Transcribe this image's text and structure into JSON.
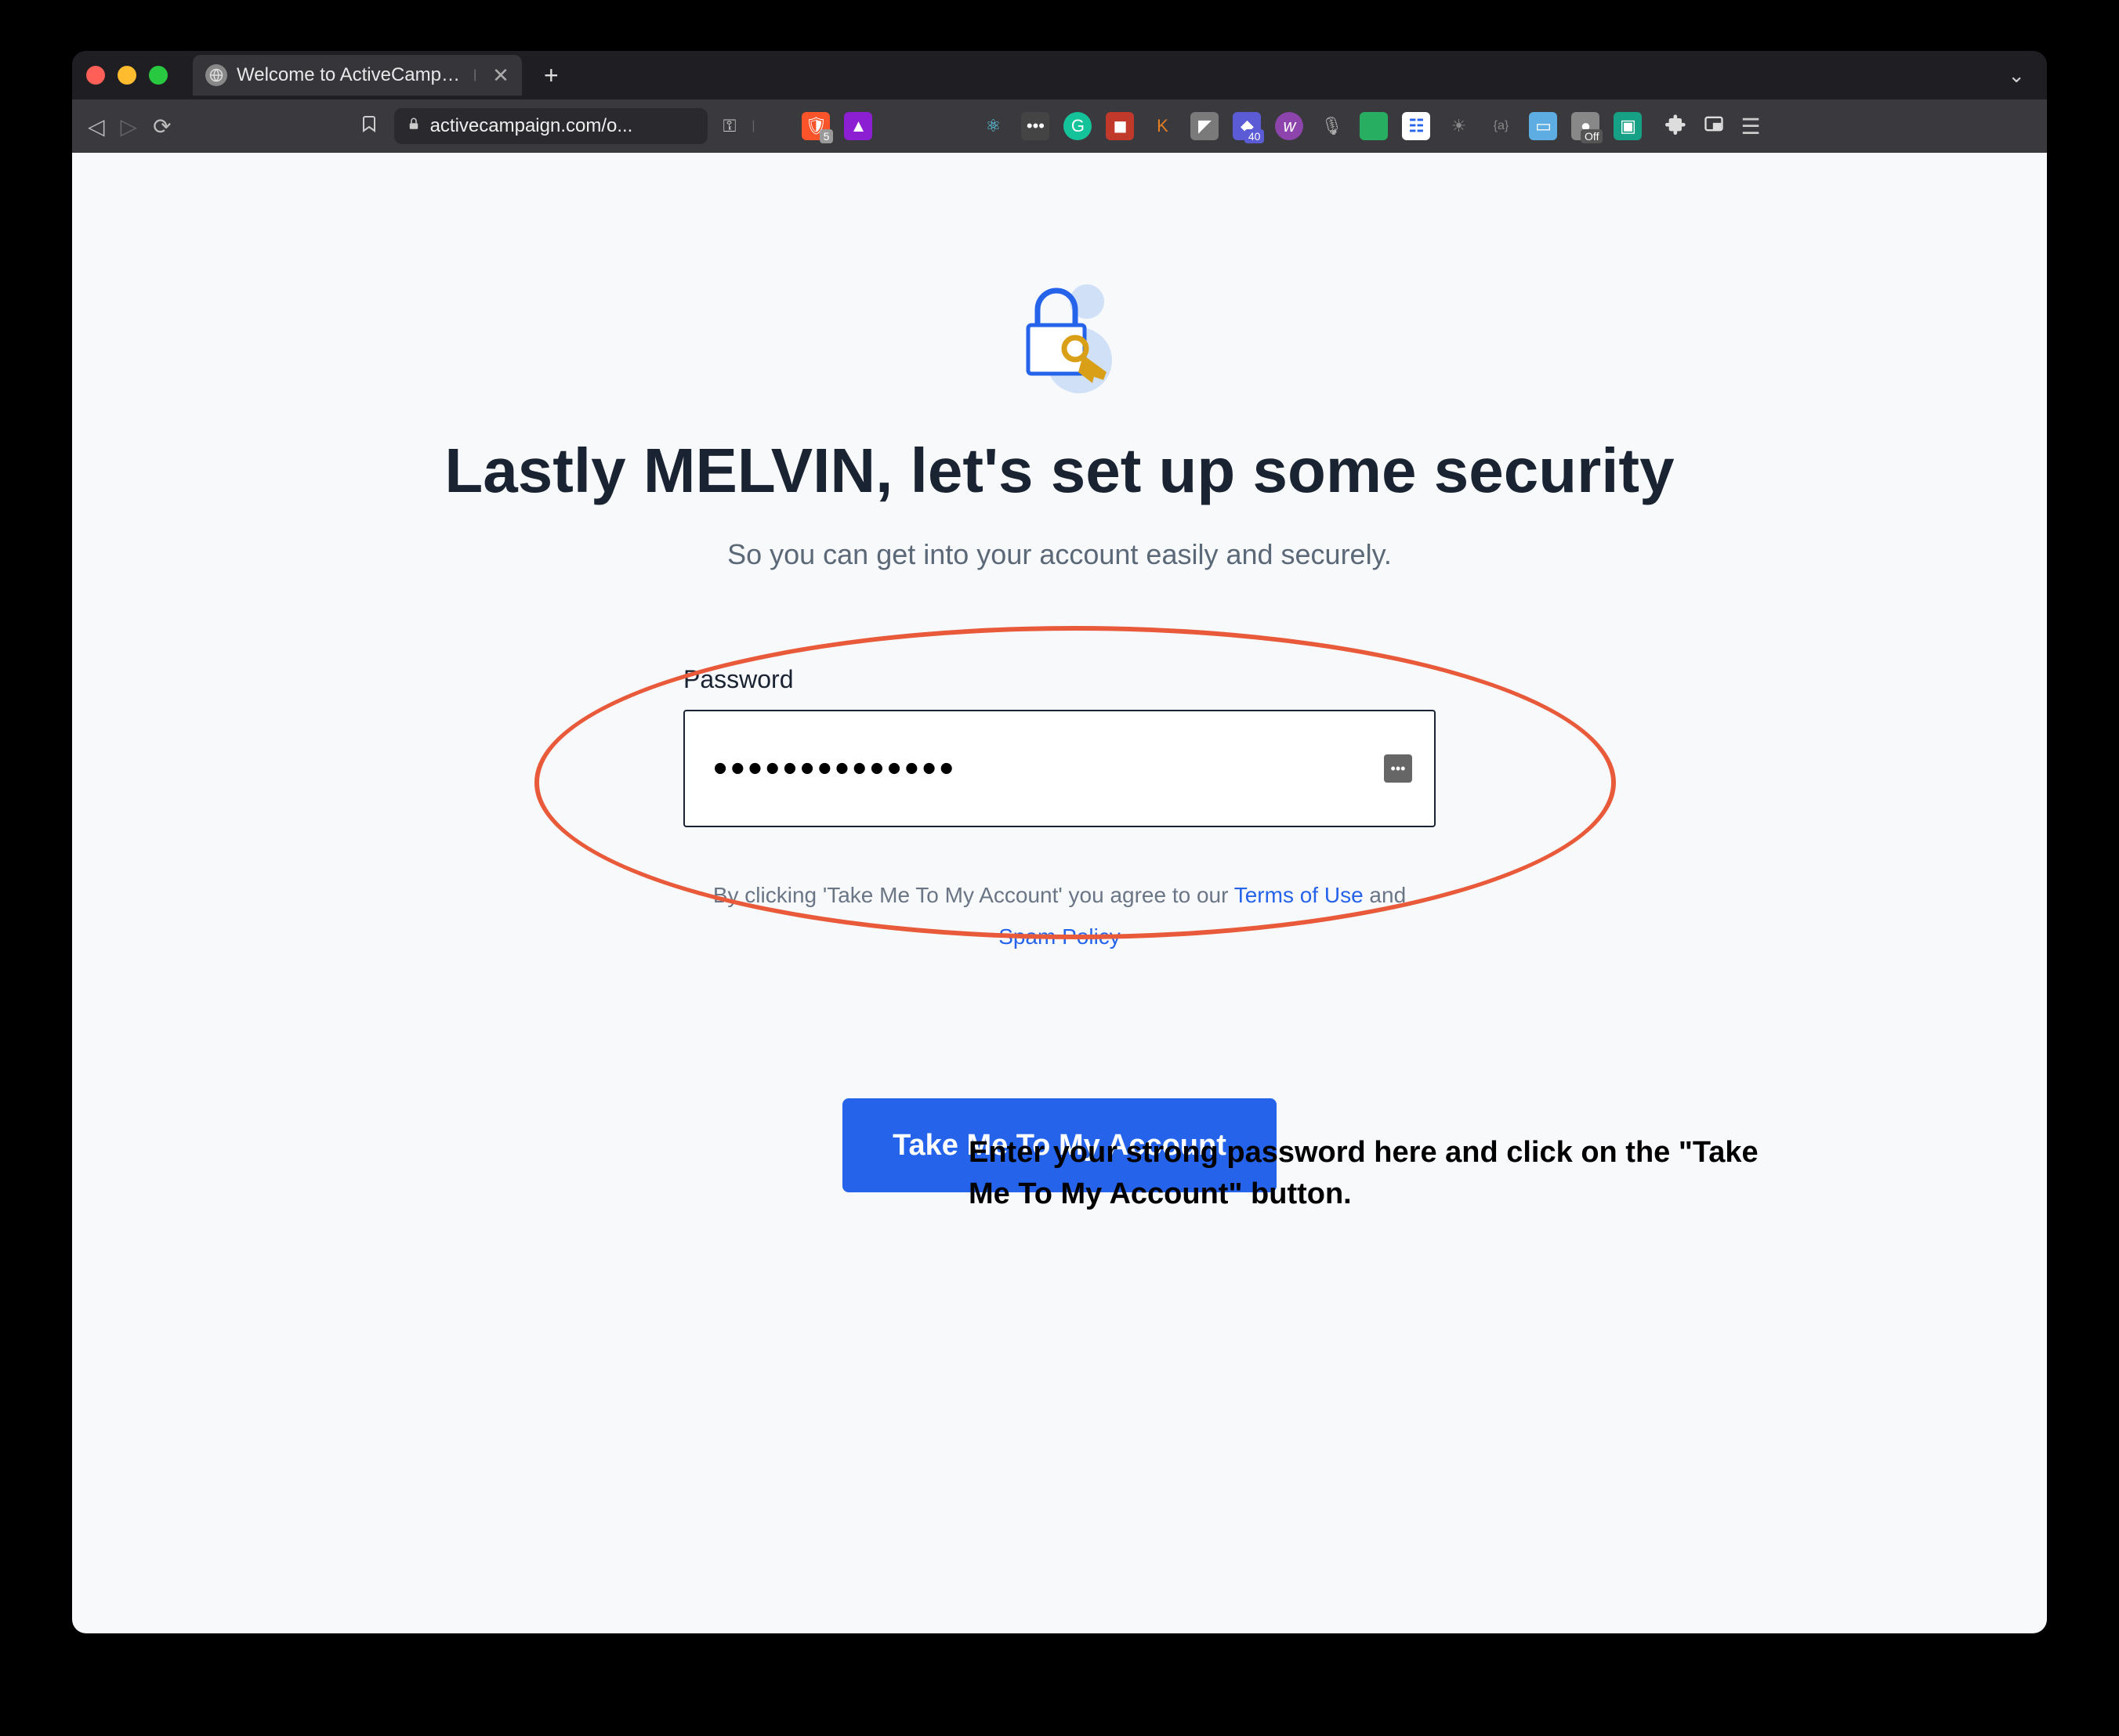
{
  "browser": {
    "tab_title": "Welcome to ActiveCampaign -",
    "url_display": "activecampaign.com/o...",
    "ext_badge_40": "40",
    "ext_badge_5": "5",
    "ext_off": "Off",
    "ext_k": "K"
  },
  "page": {
    "heading": "Lastly MELVIN, let's set up some security",
    "subheading": "So you can get into your account easily and securely.",
    "field_label": "Password",
    "password_value": "••••••••••••••",
    "terms_prefix": "By clicking 'Take Me To My Account' you agree to our ",
    "terms_link": "Terms of Use",
    "terms_mid": " and ",
    "spam_link": "Spam Policy",
    "cta_label": "Take Me To My Account"
  },
  "annotation": {
    "text": "Enter your strong password here and click on the \"Take Me To My Account\" button."
  }
}
